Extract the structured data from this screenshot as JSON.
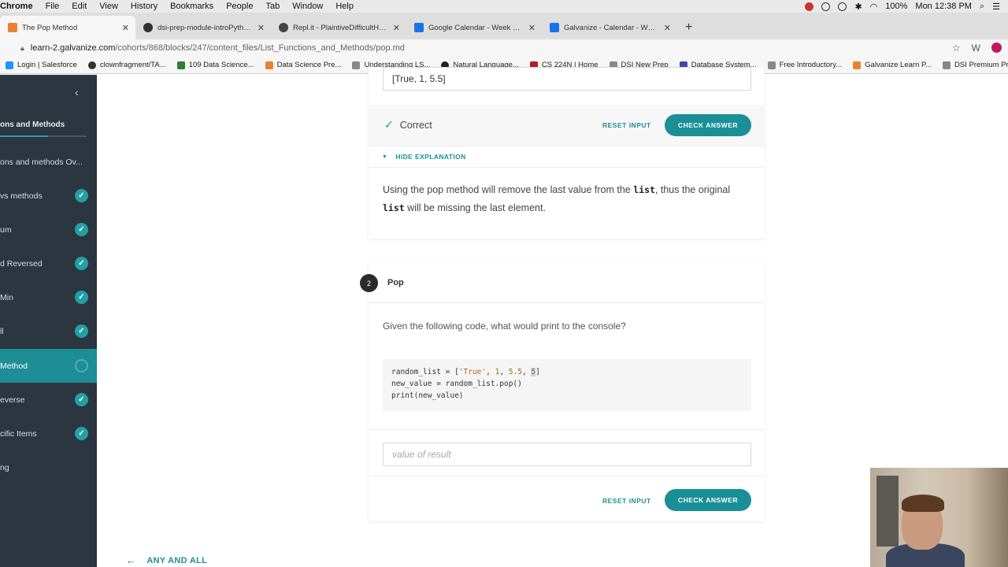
{
  "menubar": {
    "apple": "",
    "app_name": "Chrome",
    "items": [
      "File",
      "Edit",
      "View",
      "History",
      "Bookmarks",
      "People",
      "Tab",
      "Window",
      "Help"
    ],
    "battery": "100%",
    "clock": "Mon 12:38 PM"
  },
  "tabs": [
    {
      "title": "The Pop Method",
      "active": true,
      "color": "#e8822d"
    },
    {
      "title": "dsi-prep-module-introPython/",
      "active": false,
      "color": "#333333"
    },
    {
      "title": "Repl.it - PlaintiveDifficultHyper",
      "active": false,
      "color": "#444444"
    },
    {
      "title": "Google Calendar - Week of Ma",
      "active": false,
      "color": "#1a73e8"
    },
    {
      "title": "Galvanize - Calendar - Week o",
      "active": false,
      "color": "#1a73e8"
    }
  ],
  "address": {
    "host": "learn-2.galvanize.com",
    "path": "/cohorts/868/blocks/247/content_files/List_Functions_and_Methods/pop.md"
  },
  "bookmarks": [
    {
      "label": "Login | Salesforce",
      "color": "#1b96ff"
    },
    {
      "label": "clownfragment/TA...",
      "color": "#333333"
    },
    {
      "label": "109 Data Science...",
      "color": "#2e7d32"
    },
    {
      "label": "Data Science Pre...",
      "color": "#e8822d"
    },
    {
      "label": "Understanding LS...",
      "color": "#888888"
    },
    {
      "label": "Natural Language...",
      "color": "#222222"
    },
    {
      "label": "CS 224N | Home",
      "color": "#b71c1c"
    },
    {
      "label": "DSI New Prep",
      "color": "#888888"
    },
    {
      "label": "Database System...",
      "color": "#3949ab"
    },
    {
      "label": "Free Introductory...",
      "color": "#888888"
    },
    {
      "label": "Galvanize Learn P...",
      "color": "#e8822d"
    },
    {
      "label": "DSI Premium Prep...",
      "color": "#888888"
    }
  ],
  "sidebar": {
    "heading": "ons and Methods",
    "progress": 0.55,
    "items": [
      {
        "label": "ons and methods Ov...",
        "state": "none"
      },
      {
        "label": "vs methods",
        "state": "done"
      },
      {
        "label": "um",
        "state": "done"
      },
      {
        "label": "d Reversed",
        "state": "done"
      },
      {
        "label": "Min",
        "state": "done"
      },
      {
        "label": "ll",
        "state": "done"
      },
      {
        "label": "Method",
        "state": "current"
      },
      {
        "label": "everse",
        "state": "done"
      },
      {
        "label": "cific Items",
        "state": "done"
      },
      {
        "label": "ng",
        "state": "none"
      }
    ]
  },
  "q1": {
    "answer_value": "[True, 1, 5.5]",
    "status": "Correct",
    "reset_label": "RESET INPUT",
    "check_label": "CHECK ANSWER",
    "explanation_toggle": "HIDE EXPLANATION",
    "explanation": {
      "part1": "Using the pop method will remove the last value from the ",
      "code1": "list",
      "part2": ", thus the original ",
      "code2": "list",
      "part3": " will be missing the last element."
    }
  },
  "q2": {
    "number": "2",
    "title": "Pop",
    "prompt": "Given the following code, what would print to the console?",
    "code": {
      "l1_a": "random_list = [",
      "l1_str": "'True'",
      "l1_b": ", ",
      "l1_n1": "1",
      "l1_c": ", ",
      "l1_n2": "5.5",
      "l1_d": ", ",
      "l1_n3": "5",
      "l1_e": "]",
      "l2": "new_value = random_list.pop()",
      "l3": "print(new_value)"
    },
    "input_placeholder": "value of result",
    "reset_label": "RESET INPUT",
    "check_label": "CHECK ANSWER"
  },
  "prev_nav": "ANY AND ALL"
}
